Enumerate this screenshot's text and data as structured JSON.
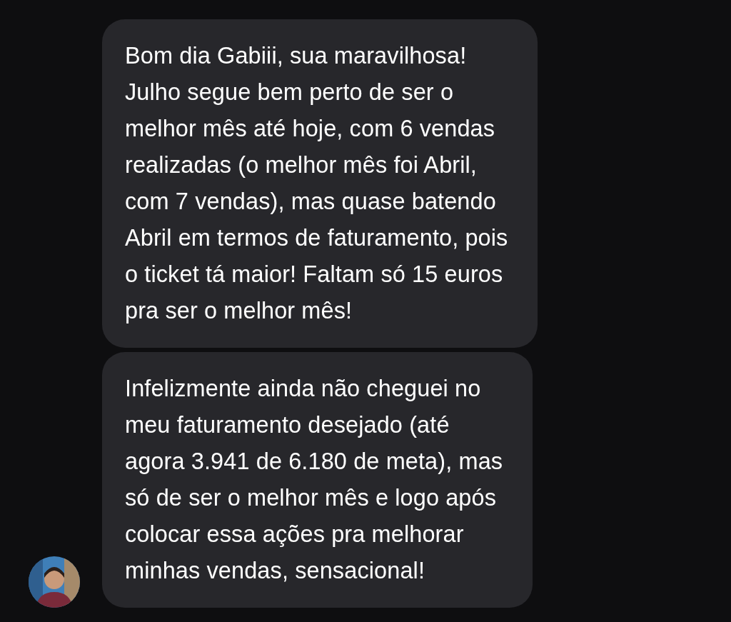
{
  "messages": [
    {
      "text": "Bom dia Gabiii, sua maravilhosa!\nJulho segue bem perto de ser o\nmelhor mês até hoje, com 6 vendas\nrealizadas (o melhor mês foi Abril,\ncom 7 vendas), mas quase batendo\nAbril em termos de faturamento, pois\no ticket tá maior! Faltam só 15 euros\npra ser o melhor mês!",
      "avatar": false
    },
    {
      "text": "Infelizmente ainda não cheguei no\nmeu faturamento desejado (até\nagora 3.941 de 6.180 de meta), mas\nsó de ser o melhor mês e logo após\ncolocar essa ações pra melhorar\nminhas vendas, sensacional!",
      "avatar": true
    }
  ]
}
